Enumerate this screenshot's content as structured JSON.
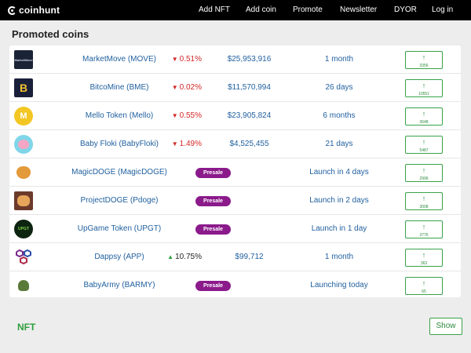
{
  "brand": {
    "name": "coinhunt"
  },
  "nav": {
    "add_nft": "Add NFT",
    "add_coin": "Add coin",
    "promote": "Promote",
    "newsletter": "Newsletter",
    "dyor": "DYOR",
    "login": "Log in"
  },
  "promoted": {
    "title": "Promoted coins",
    "rows": [
      {
        "name": "MarketMove (MOVE)",
        "change": "0.51%",
        "dir": "down",
        "price": "$25,953,916",
        "launch": "1 month",
        "vote_count": "3356"
      },
      {
        "name": "BitcoMine (BME)",
        "change": "0.02%",
        "dir": "down",
        "price": "$11,570,994",
        "launch": "26 days",
        "vote_count": "10551"
      },
      {
        "name": "Mello Token (Mello)",
        "change": "0.55%",
        "dir": "down",
        "price": "$23,905,824",
        "launch": "6 months",
        "vote_count": "3648"
      },
      {
        "name": "Baby Floki (BabyFloki)",
        "change": "1.49%",
        "dir": "down",
        "price": "$4,525,455",
        "launch": "21 days",
        "vote_count": "5487"
      },
      {
        "name": "MagicDOGE (MagicDOGE)",
        "presale": "Presale",
        "launch": "Launch in 4 days",
        "vote_count": "2996"
      },
      {
        "name": "ProjectDOGE (Pdoge)",
        "presale": "Presale",
        "launch": "Launch in 2 days",
        "vote_count": "3008"
      },
      {
        "name": "UpGame Token (UPGT)",
        "presale": "Presale",
        "launch": "Launch in 1 day",
        "vote_count": "3776"
      },
      {
        "name": "Dappsy (APP)",
        "change": "10.75%",
        "dir": "up",
        "price": "$99,712",
        "launch": "1 month",
        "vote_count": "363"
      },
      {
        "name": "BabyArmy (BARMY)",
        "presale": "Presale",
        "launch": "Launching today",
        "vote_count": "65"
      }
    ]
  },
  "vote": {
    "arrow": "↑"
  },
  "colors": {
    "down": "#d42626",
    "up": "#2e9e3c",
    "presale": "#8b1a8b",
    "link": "#1f5f9e",
    "accent": "#39a24a"
  },
  "nft": {
    "title": "NFT",
    "show_label": "Show"
  }
}
